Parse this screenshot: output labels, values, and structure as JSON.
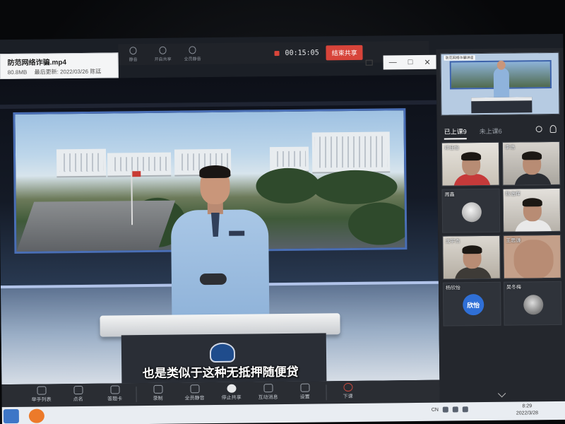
{
  "meeting_bar": {
    "buttons": [
      "静音",
      "开启共享",
      "全员静音"
    ],
    "timer": "00:15:05",
    "end_share_label": "结束共享"
  },
  "file": {
    "name": "防范网络诈骗.mp4",
    "size": "80.8MB",
    "modified": "最后更新: 2022/03/26 陈廷"
  },
  "window_controls": [
    "—",
    "□",
    "✕"
  ],
  "video": {
    "subtitle": "也是类似于这种无抵押随便贷"
  },
  "controls": [
    {
      "label": "举手列表",
      "icon": "hand-icon"
    },
    {
      "label": "点名",
      "icon": "roll-call-icon"
    },
    {
      "label": "答题卡",
      "icon": "answer-card-icon"
    },
    {
      "label": "录制",
      "icon": "record-icon"
    },
    {
      "label": "全员静音",
      "icon": "mute-all-icon"
    },
    {
      "label": "停止共享",
      "icon": "stop-share-icon"
    },
    {
      "label": "互动消息",
      "icon": "message-icon"
    },
    {
      "label": "设置",
      "icon": "settings-icon"
    },
    {
      "label": "下课",
      "icon": "end-class-icon"
    }
  ],
  "panel": {
    "teacher_cam_label": "防范网络诈骗讲座",
    "tabs": {
      "attended": "已上课9",
      "absent": "未上课6"
    },
    "participants": [
      {
        "name": "邓佳怡",
        "type": "camera"
      },
      {
        "name": "李浩",
        "type": "camera"
      },
      {
        "name": "周鑫",
        "type": "avatar-image"
      },
      {
        "name": "陈浩辉",
        "type": "camera"
      },
      {
        "name": "沈宇杰",
        "type": "camera"
      },
      {
        "name": "王思谦",
        "type": "camera"
      },
      {
        "name": "杨欣怡",
        "type": "avatar-text",
        "avatar_text": "欣怡"
      },
      {
        "name": "吴冬梅",
        "type": "avatar-image"
      }
    ]
  },
  "taskbar": {
    "lang": "CN",
    "time": "8:29",
    "date": "2022/3/28"
  }
}
